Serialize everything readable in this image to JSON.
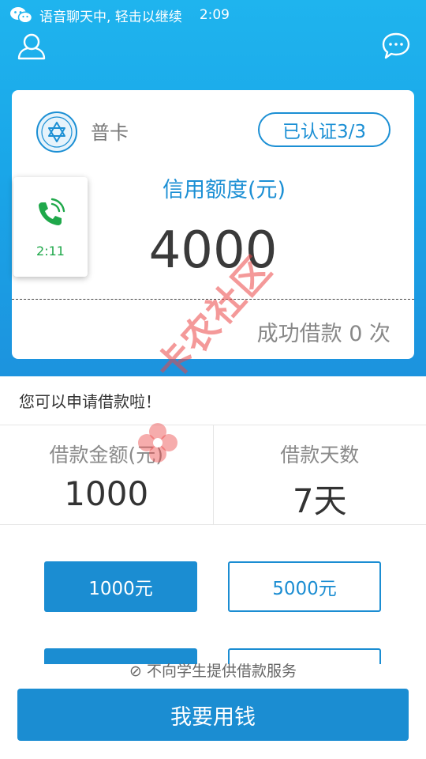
{
  "status_bar": {
    "notification": "语音聊天中, 轻击以继续",
    "time": "2:09",
    "icon": "wechat-icon"
  },
  "header": {
    "profile_icon": "user-icon",
    "chat_icon": "chat-bubble-icon"
  },
  "card": {
    "badge_icon": "star-badge-icon",
    "tier": "普卡",
    "verification": "已认证3/3",
    "credit_label": "信用额度(元)",
    "credit_value": "4000",
    "success_count": "成功借款 0 次"
  },
  "call_overlay": {
    "icon": "phone-icon",
    "time": "2:11"
  },
  "notice": "您可以申请借款啦！",
  "loan_info": {
    "amount_label": "借款金额(元)",
    "amount_value": "1000",
    "days_label": "借款天数",
    "days_value": "7天"
  },
  "amount_options": [
    {
      "label": "1000元",
      "selected": true
    },
    {
      "label": "5000元",
      "selected": false
    }
  ],
  "service_notice": "不向学生提供借款服务",
  "cta": "我要用钱",
  "watermark": {
    "text": "卡农社区"
  },
  "colors": {
    "primary": "#1b8dd2",
    "header_top": "#1fb4ee",
    "call_green": "#1fa84a"
  }
}
